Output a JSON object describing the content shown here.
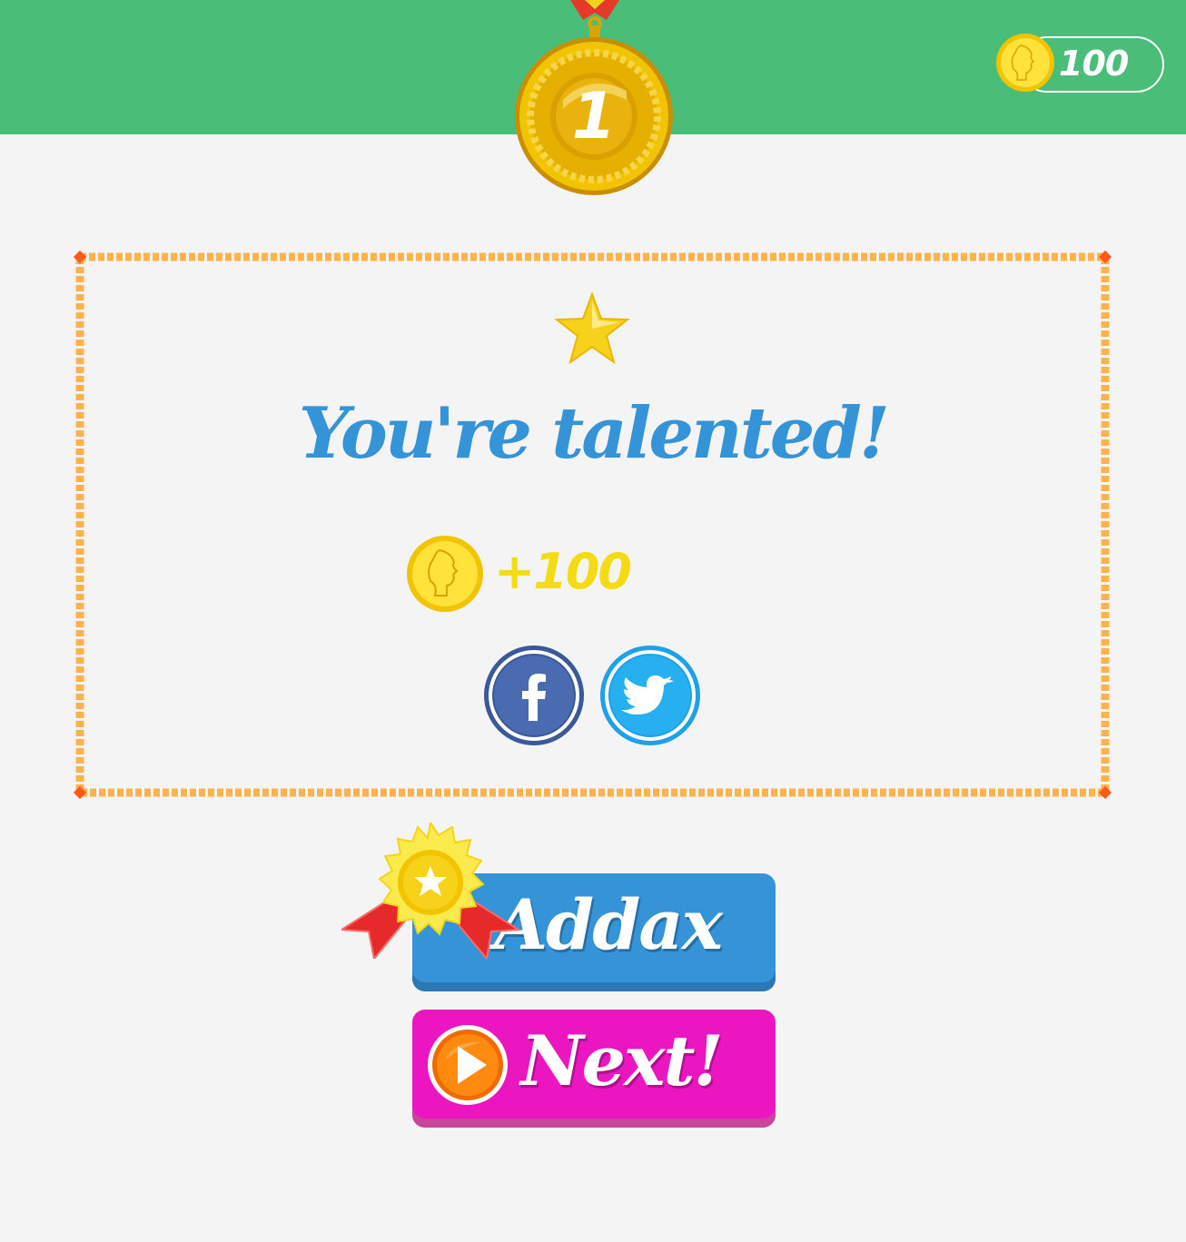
{
  "header": {
    "coin_balance": "100",
    "level_medal_number": "1"
  },
  "result": {
    "stars": 1,
    "headline": "You're talented!",
    "reward_amount": "+100"
  },
  "share": {
    "facebook_icon": "facebook-icon",
    "twitter_icon": "twitter-icon"
  },
  "buttons": {
    "addax_label": "Addax",
    "next_label": "Next!"
  },
  "colors": {
    "topbar": "#4abd78",
    "headline": "#3593d8",
    "reward": "#f4dc14",
    "addax_button": "#3593d8",
    "next_button": "#ec16c0",
    "panel_border": "#ffb24d"
  }
}
